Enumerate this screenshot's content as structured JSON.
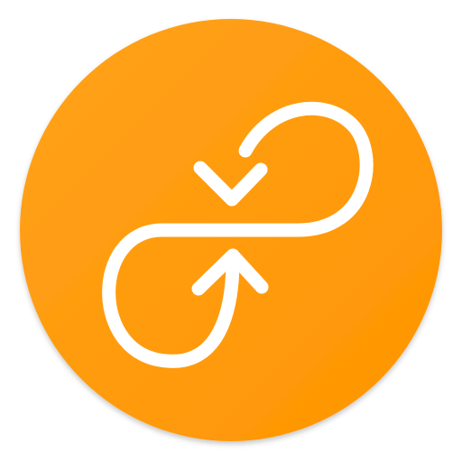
{
  "icon": {
    "name": "loop-arrows-icon",
    "background_color": "#FF9C10",
    "background_color_light": "#FFA21C",
    "background_color_dark": "#FF9500",
    "glyph_color": "#FFFFFF"
  }
}
